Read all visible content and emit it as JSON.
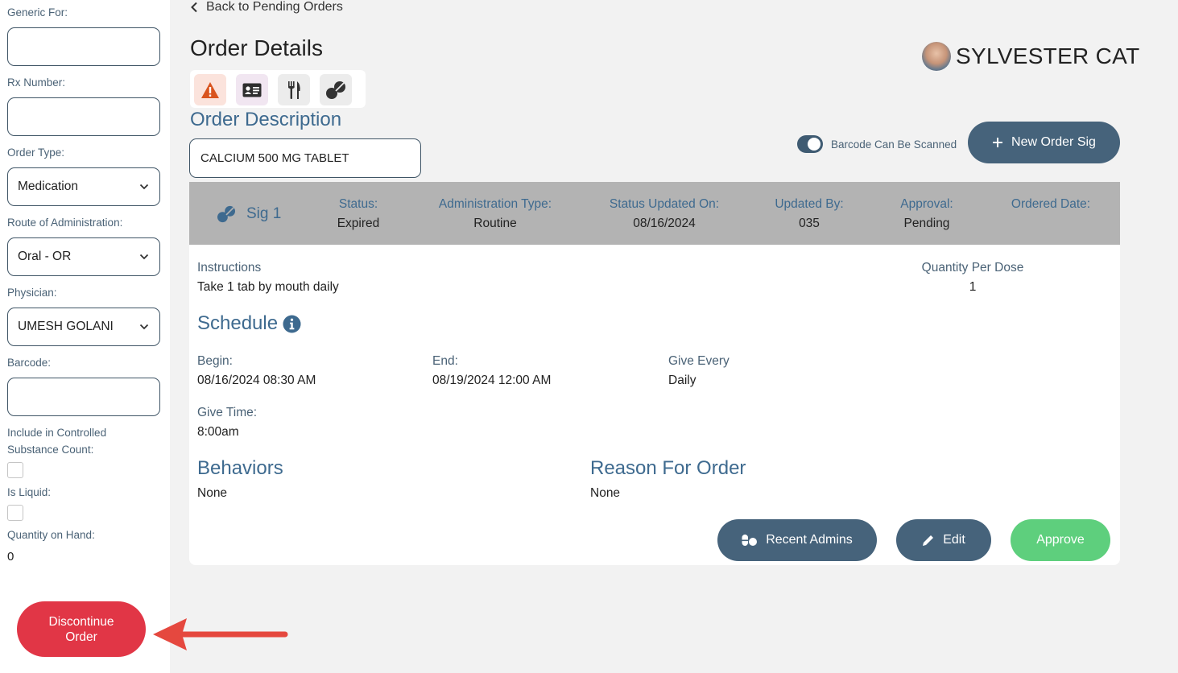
{
  "sidebar": {
    "generic_for_label": "Generic For:",
    "generic_for_value": "",
    "rx_number_label": "Rx Number:",
    "rx_number_value": "",
    "order_type_label": "Order Type:",
    "order_type_value": "Medication",
    "route_label": "Route of Administration:",
    "route_value": "Oral - OR",
    "physician_label": "Physician:",
    "physician_value": "UMESH GOLANI",
    "barcode_label": "Barcode:",
    "barcode_value": "",
    "controlled_label_1": "Include in Controlled",
    "controlled_label_2": "Substance Count:",
    "liquid_label": "Is Liquid:",
    "qoh_label": "Quantity on Hand:",
    "qoh_value": "0",
    "discontinue_line1": "Discontinue",
    "discontinue_line2": "Order"
  },
  "header": {
    "back_label": "Back to Pending Orders",
    "title": "Order Details",
    "patient_name": "SYLVESTER CAT",
    "icons": [
      "warning-icon",
      "id-card-icon",
      "utensils-icon",
      "pills-icon"
    ]
  },
  "order": {
    "description_heading": "Order Description",
    "description_value": "CALCIUM 500 MG TABLET",
    "barcode_toggle_label": "Barcode Can Be Scanned",
    "barcode_toggle_on": true,
    "new_sig_label": "New Order Sig"
  },
  "sig": {
    "title": "Sig 1",
    "status_label": "Status:",
    "status_value": "Expired",
    "admin_type_label": "Administration Type:",
    "admin_type_value": "Routine",
    "updated_on_label": "Status Updated On:",
    "updated_on_value": "08/16/2024",
    "updated_by_label": "Updated By:",
    "updated_by_value": "035",
    "approval_label": "Approval:",
    "approval_value": "Pending",
    "ordered_date_label": "Ordered Date:",
    "ordered_date_value": "",
    "instructions_label": "Instructions",
    "instructions_value": "Take 1 tab by mouth daily",
    "qty_label": "Quantity Per Dose",
    "qty_value": "1",
    "schedule_heading": "Schedule",
    "begin_label": "Begin:",
    "begin_value": "08/16/2024 08:30 AM",
    "end_label": "End:",
    "end_value": "08/19/2024 12:00 AM",
    "give_every_label": "Give Every",
    "give_every_value": "Daily",
    "give_time_label": "Give Time:",
    "give_time_value": "8:00am",
    "behaviors_heading": "Behaviors",
    "behaviors_value": "None",
    "reason_heading": "Reason For Order",
    "reason_value": "None",
    "recent_admins_label": "Recent Admins",
    "edit_label": "Edit",
    "approve_label": "Approve"
  },
  "colors": {
    "primary": "#46637b",
    "danger": "#e13646",
    "success": "#5ecf7d",
    "heading": "#3e6a8f",
    "annotation_arrow": "#e5483f"
  }
}
